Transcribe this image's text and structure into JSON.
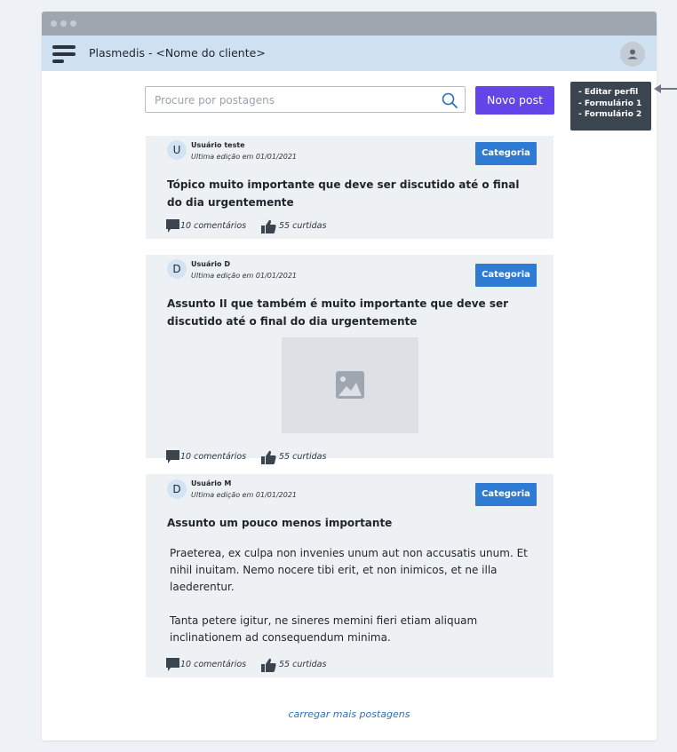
{
  "app": {
    "title": "Plasmedis - <Nome do cliente>"
  },
  "search": {
    "placeholder": "Procure por postagens"
  },
  "toolbar": {
    "new_post_label": "Novo post"
  },
  "profile_menu": {
    "items": [
      "- Editar perfil",
      "- Formulário 1",
      "- Formulário 2"
    ]
  },
  "posts": [
    {
      "avatar_initial": "U",
      "user": "Usuário teste",
      "edited": "Ultima edição em 01/01/2021",
      "category": "Categoria",
      "title": "Tópico muito importante que deve ser discutido até o final do dia urgentemente",
      "comments": "10 comentários",
      "likes": "55 curtidas"
    },
    {
      "avatar_initial": "D",
      "user": "Usuário D",
      "edited": "Ultima edição em 01/01/2021",
      "category": "Categoria",
      "title": "Assunto II que também é muito importante que deve ser discutido até o final do dia  urgentemente",
      "comments": "10 comentários",
      "likes": "55 curtidas"
    },
    {
      "avatar_initial": "D",
      "user": "Usuário M",
      "edited": "Ultima edição em 01/01/2021",
      "category": "Categoria",
      "title": "Assunto um pouco menos importante",
      "body": [
        "Praeterea, ex culpa non invenies unum aut non accusatis unum. Et nihil inuitam. Nemo nocere tibi erit, et non inimicos, et ne illa laederentur.",
        "Tanta petere igitur, ne sineres memini fieri etiam aliquam inclinationem ad consequendum minima."
      ],
      "comments": "10 comentários",
      "likes": "55 curtidas"
    }
  ],
  "load_more_label": "carregar mais postagens",
  "colors": {
    "accent": "#6246ea",
    "category": "#2f7bd3",
    "app_bar": "#cfe0f1",
    "tooltip": "#3b4550"
  },
  "icons": [
    "menu-icon",
    "user-icon",
    "search-icon",
    "image-icon",
    "comment-icon",
    "thumbs-up-icon",
    "arrow-left-icon"
  ]
}
